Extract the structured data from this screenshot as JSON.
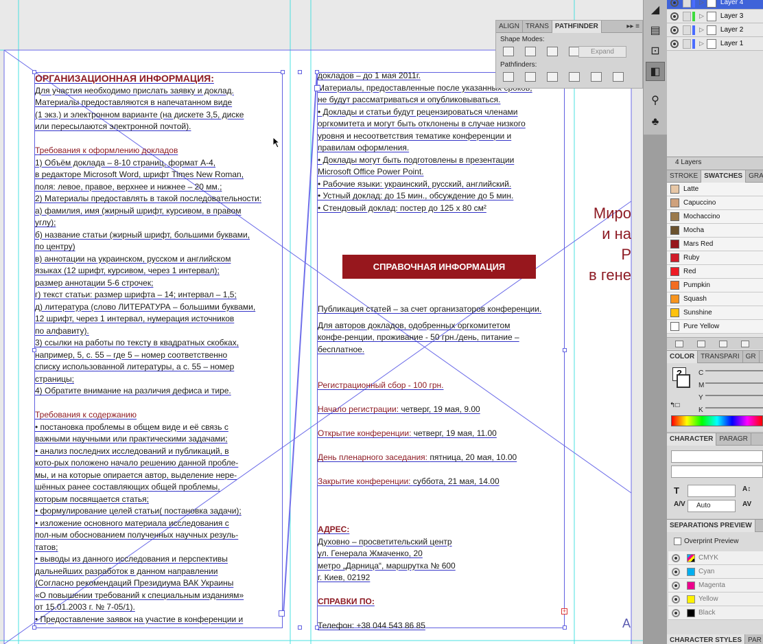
{
  "document": {
    "left_column": [
      {
        "t": "ОРГАНИЗАЦИОННАЯ ИНФОРМАЦИЯ:",
        "c": "head"
      },
      {
        "t": "Для участия необходимо прислать заявку и доклад."
      },
      {
        "t": "Материалы предоставляются в напечатанном виде"
      },
      {
        "t": "(1 экз.) и электронном варианте (на дискете 3,5, диске"
      },
      {
        "t": "или пересылаются электронной почтой)."
      },
      {
        "t": "",
        "c": "sp"
      },
      {
        "t": "Требования к оформлению докладов",
        "c": "red"
      },
      {
        "t": "1)  Объём доклада – 8-10 страниц, формат А-4,"
      },
      {
        "t": "     в редакторе Microsoft  Word, шрифт Times New Roman,"
      },
      {
        "t": "     поля: левое, правое, верхнее и нижнее – 20 мм.;"
      },
      {
        "t": "2)  Материалы предоставлять в такой последовательности:"
      },
      {
        "t": "   а) фамилия, имя (жирный шрифт, курсивом, в правом"
      },
      {
        "t": "       углу);"
      },
      {
        "t": "   б) название статьи (жирный шрифт, большими буквами,"
      },
      {
        "t": "       по центру)"
      },
      {
        "t": "   в) аннотации на украинском, русском и английском"
      },
      {
        "t": "        языках (12 шрифт, курсивом, через 1 интервал);"
      },
      {
        "t": "       размер аннотации 5-6 строчек;"
      },
      {
        "t": "   г) текст статьи: размер шрифта – 14; интервал – 1,5;"
      },
      {
        "t": "   д) литература (слово ЛИТЕРАТУРА – большими буквами,"
      },
      {
        "t": "       12 шрифт, через 1 интервал, нумерация источников"
      },
      {
        "t": "       по алфавиту)."
      },
      {
        "t": "3) ссылки на работы по тексту в квадратных  скобках,"
      },
      {
        "t": "    например,   5, с. 55 – где 5 – номер соответственно"
      },
      {
        "t": "    списку использованной литературы, а с. 55 – номер"
      },
      {
        "t": "    страницы;"
      },
      {
        "t": "4) Обратите внимание на различия дефиса и тире."
      },
      {
        "t": "",
        "c": "sp"
      },
      {
        "t": "Требования к содержанию",
        "c": "red"
      },
      {
        "t": "• постановка проблемы в общем виде и её связь с"
      },
      {
        "t": "   важными научными или практическими задачами;"
      },
      {
        "t": "• анализ последних исследований и публикаций, в"
      },
      {
        "t": "   кото-рых положено начало решению данной пробле-"
      },
      {
        "t": "   мы, и на которые опирается автор, выделение нере-"
      },
      {
        "t": "   шённых ранее составляющих общей проблемы,"
      },
      {
        "t": "   которым посвящается статья;"
      },
      {
        "t": "• формулирование целей статьи( постановка задачи);"
      },
      {
        "t": "• изложение основного материала исследования  с"
      },
      {
        "t": "   пол-ным обоснованием полученных научных резуль-"
      },
      {
        "t": "   татов;"
      },
      {
        "t": "• выводы из данного исследования и перспективы"
      },
      {
        "t": "   дальнейших разработок в данном направлении"
      },
      {
        "t": "   (Согласно рекомендаций Президиума ВАК Украины"
      },
      {
        "t": "   «О повышении требований к специальным изданиям»"
      },
      {
        "t": "   от 15.01.2003 г. № 7-05/1)."
      },
      {
        "t": "• Предоставление заявок на участие в конференции и"
      }
    ],
    "mid_column_top": [
      {
        "t": "   докладов – до 1 мая 2011г."
      },
      {
        "t": "   Материалы, предоставленные после указанных сроков,"
      },
      {
        "t": "   не будут рассматриваться и опубликовываться."
      },
      {
        "t": "• Доклады и статьи будут рецензироваться членами"
      },
      {
        "t": "   оргкомитета и могут быть отклонены в случае низкого"
      },
      {
        "t": "   уровня и несоответствия тематике конференции и"
      },
      {
        "t": "   правилам оформления."
      },
      {
        "t": "• Доклады могут быть подготовлены в презентации"
      },
      {
        "t": "   Microsoft Office Power Point."
      },
      {
        "t": "• Рабочие языки: украинский, русский, английский."
      },
      {
        "t": "• Устный доклад: до 15 мин., обсуждение до 5 мин."
      },
      {
        "t": "• Стендовый доклад: постер до 125 х 80 см²"
      }
    ],
    "banner": "СПРАВОЧНАЯ ИНФОРМАЦИЯ",
    "mid_column_bottom": [
      {
        "t": "Публикация статей – за счет организаторов конференции."
      },
      {
        "t": "",
        "c": "sp4"
      },
      {
        "t": "Для авторов докладов, одобренных оргкомитетом"
      },
      {
        "t": "конфе-ренции, проживание - 50 грн./день, питание –"
      },
      {
        "t": "бесплатное."
      },
      {
        "t": "",
        "c": "sp"
      },
      {
        "t": "",
        "c": "sp"
      },
      {
        "t": "Регистрационный сбор - 100 грн.",
        "c": "red"
      },
      {
        "t": "",
        "c": "sp"
      },
      {
        "r": "Начало регистрации: ",
        "t": "четверг, 19 мая, 9.00"
      },
      {
        "t": "",
        "c": "sp"
      },
      {
        "r": "Открытие конференции: ",
        "t": "четверг, 19 мая, 11.00"
      },
      {
        "t": "",
        "c": "sp"
      },
      {
        "r": "День пленарного заседания: ",
        "t": "пятница, 20 мая, 10.00"
      },
      {
        "t": "",
        "c": "sp"
      },
      {
        "r": "Закрытие конференции: ",
        "t": "суббота, 21 мая, 14.00"
      },
      {
        "t": "",
        "c": "sp"
      },
      {
        "t": "",
        "c": "sp"
      },
      {
        "t": "",
        "c": "sp"
      },
      {
        "t": "АДРЕС:",
        "c": "redbold"
      },
      {
        "t": "Духовно – просветительский центр"
      },
      {
        "t": "ул. Генерала Жмаченко, 20"
      },
      {
        "t": "метро „Дарница“, маршрутка № 600"
      },
      {
        "t": "г. Киев, 02192"
      },
      {
        "t": "",
        "c": "sp"
      },
      {
        "t": "СПРАВКИ ПО:",
        "c": "redbold"
      },
      {
        "t": "",
        "c": "sp"
      },
      {
        "t": "Телефон: +38 044 543 86 85"
      }
    ],
    "cover_lines": [
      "Миро",
      "и на",
      "Р",
      "в гене"
    ],
    "cover_letter": "A"
  },
  "pathfinder": {
    "tabs": [
      "ALIGN",
      "TRANS",
      "PATHFINDER"
    ],
    "shape_modes_label": "Shape Modes:",
    "expand_label": "Expand",
    "pathfinders_label": "Pathfinders:"
  },
  "layers": {
    "rows": [
      {
        "name": "Layer 4",
        "color": "#4a6cff",
        "selected": true
      },
      {
        "name": "Layer 3",
        "color": "#3ddc3d",
        "selected": false
      },
      {
        "name": "Layer 2",
        "color": "#4a6cff",
        "selected": false
      },
      {
        "name": "Layer 1",
        "color": "#4a6cff",
        "selected": false
      }
    ],
    "count": "4 Layers"
  },
  "swatches": {
    "tabs": [
      "STROKE",
      "SWATCHES",
      "GRA"
    ],
    "items": [
      {
        "name": "Latte",
        "color": "#e7c7a6"
      },
      {
        "name": "Capuccino",
        "color": "#cfa17c"
      },
      {
        "name": "Mochaccino",
        "color": "#9b7a4c"
      },
      {
        "name": "Mocha",
        "color": "#6b522e"
      },
      {
        "name": "Mars Red",
        "color": "#97171d"
      },
      {
        "name": "Ruby",
        "color": "#d11c2a"
      },
      {
        "name": "Red",
        "color": "#ee1c25"
      },
      {
        "name": "Pumpkin",
        "color": "#f26c21"
      },
      {
        "name": "Squash",
        "color": "#f7941e"
      },
      {
        "name": "Sunshine",
        "color": "#ffc20e"
      },
      {
        "name": "Pure Yellow",
        "color": "#ffffff"
      }
    ]
  },
  "color_panel": {
    "tabs": [
      "COLOR",
      "TRANSPARI",
      "GR"
    ],
    "channels": [
      "C",
      "M",
      "Y",
      "K"
    ]
  },
  "character": {
    "tabs": [
      "CHARACTER",
      "PARAGR"
    ],
    "leading": "Auto"
  },
  "separations": {
    "title": "SEPARATIONS PREVIEW",
    "overprint_label": "Overprint Preview",
    "rows": [
      {
        "name": "CMYK",
        "color": "#cccccc"
      },
      {
        "name": "Cyan",
        "color": "#00aeef"
      },
      {
        "name": "Magenta",
        "color": "#ec008c"
      },
      {
        "name": "Yellow",
        "color": "#fff200"
      },
      {
        "name": "Black",
        "color": "#000000"
      }
    ]
  },
  "bottom_tabs": [
    "CHARACTER STYLES",
    "PAR"
  ]
}
